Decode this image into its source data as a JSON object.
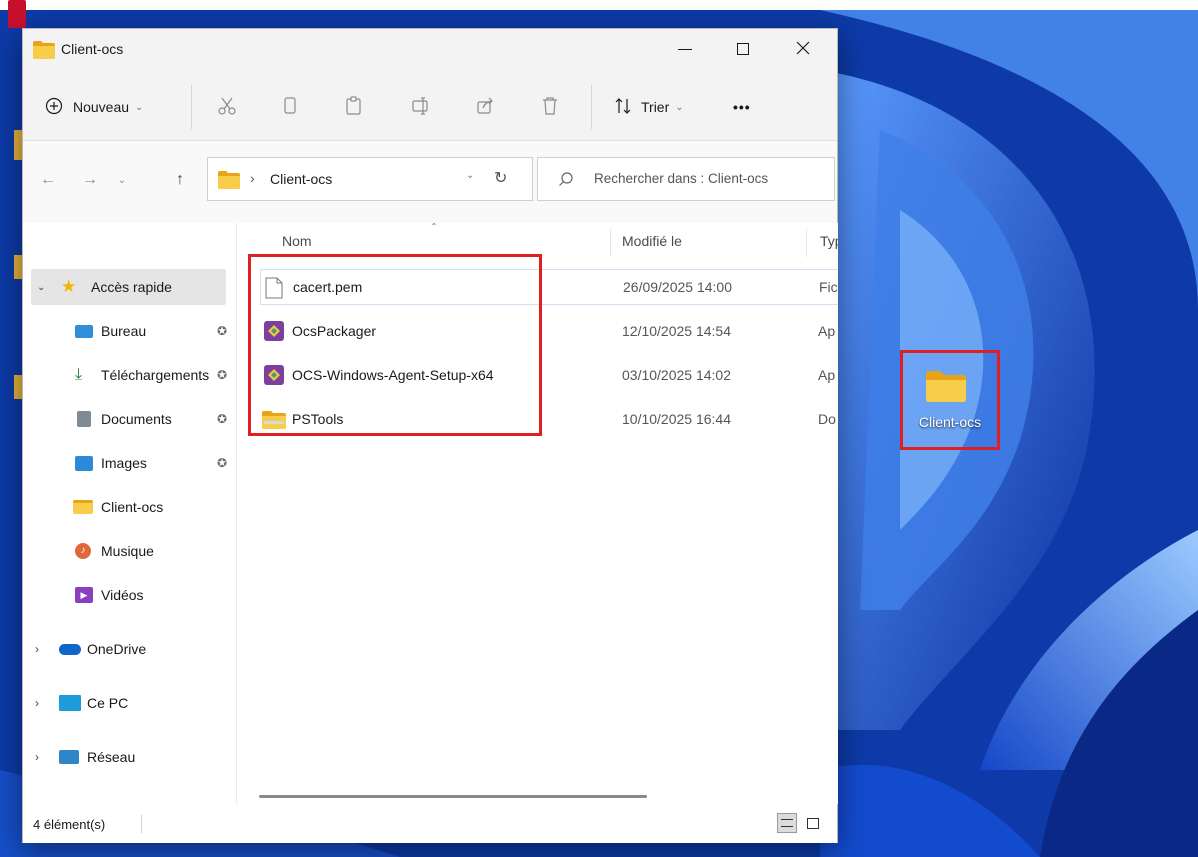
{
  "window": {
    "title": "Client-ocs"
  },
  "toolbar": {
    "new_label": "Nouveau",
    "sort_label": "Trier",
    "more_label": "•••"
  },
  "address": {
    "separator": "›",
    "path": "Client-ocs"
  },
  "search": {
    "placeholder": "Rechercher dans : Client-ocs"
  },
  "sidebar": {
    "quick_access": "Accès rapide",
    "items": [
      {
        "label": "Bureau",
        "pinned": true,
        "icon": "desktop-icon"
      },
      {
        "label": "Téléchargements",
        "pinned": true,
        "icon": "download-icon"
      },
      {
        "label": "Documents",
        "pinned": true,
        "icon": "documents-icon"
      },
      {
        "label": "Images",
        "pinned": true,
        "icon": "images-icon"
      },
      {
        "label": "Client-ocs",
        "pinned": false,
        "icon": "folder-icon"
      },
      {
        "label": "Musique",
        "pinned": false,
        "icon": "music-icon"
      },
      {
        "label": "Vidéos",
        "pinned": false,
        "icon": "videos-icon"
      }
    ],
    "onedrive": "OneDrive",
    "thispc": "Ce PC",
    "network": "Réseau"
  },
  "columns": {
    "name": "Nom",
    "modified": "Modifié le",
    "type": "Typ"
  },
  "files": [
    {
      "name": "cacert.pem",
      "modified": "26/09/2025 14:00",
      "type": "Fic",
      "icon": "file-icon"
    },
    {
      "name": "OcsPackager",
      "modified": "12/10/2025 14:54",
      "type": "Ap",
      "icon": "ocs-app-icon"
    },
    {
      "name": "OCS-Windows-Agent-Setup-x64",
      "modified": "03/10/2025 14:02",
      "type": "Ap",
      "icon": "ocs-app-icon"
    },
    {
      "name": "PSTools",
      "modified": "10/10/2025 16:44",
      "type": "Do",
      "icon": "zip-folder-icon"
    }
  ],
  "status": {
    "count": "4 élément(s)"
  },
  "desktop": {
    "icon_label": "Client-ocs"
  },
  "colors": {
    "highlight_box": "#e02020",
    "folder": "#f6c744",
    "ocs_icon": "#7b3fa0"
  }
}
